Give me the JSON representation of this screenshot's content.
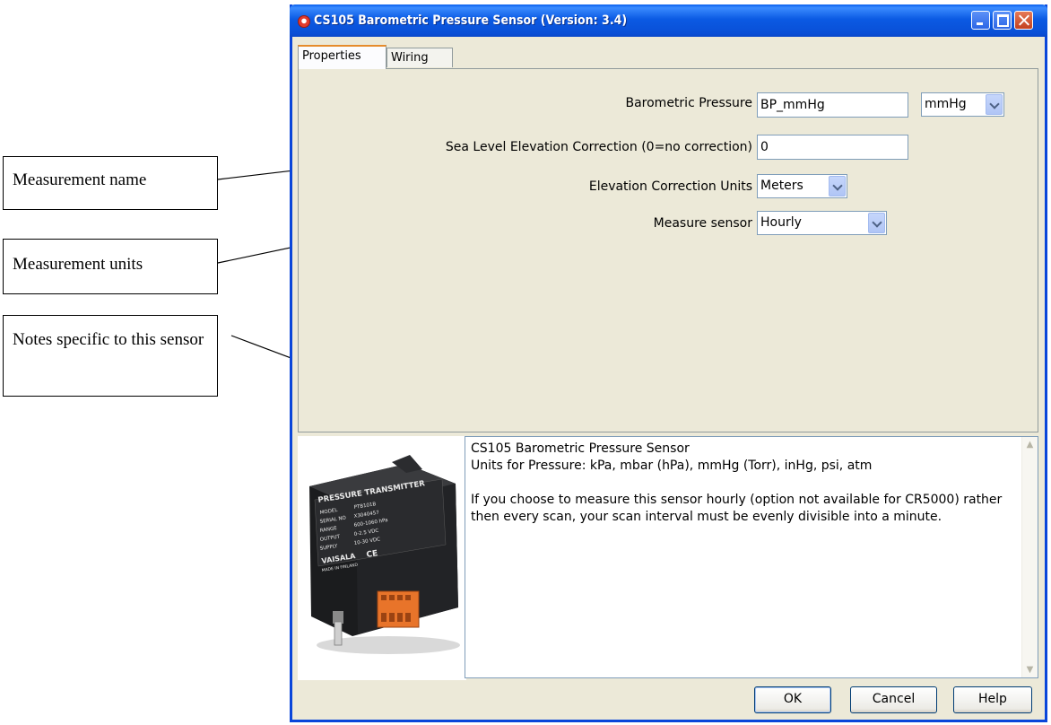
{
  "callouts": {
    "name": "Measurement name",
    "units": "Measurement units",
    "notes": "Notes specific to this sensor"
  },
  "window": {
    "title": "CS105 Barometric Pressure Sensor (Version: 3.4)"
  },
  "tabs": [
    {
      "label": "Properties",
      "active": true
    },
    {
      "label": "Wiring",
      "active": false
    }
  ],
  "form": {
    "pressure_label": "Barometric Pressure",
    "pressure_value": "BP_mmHg",
    "pressure_units": "mmHg",
    "elevation_label": "Sea Level Elevation Correction (0=no correction)",
    "elevation_value": "0",
    "elevation_units_label": "Elevation Correction Units",
    "elevation_units_value": "Meters",
    "measure_label": "Measure sensor",
    "measure_value": "Hourly"
  },
  "notes": {
    "line1": "CS105 Barometric Pressure Sensor",
    "line2": "Units for Pressure: kPa, mbar (hPa), mmHg (Torr), inHg, psi, atm",
    "line3": "If you choose to measure this sensor hourly (option not available for CR5000) rather then every scan, your scan interval must be evenly divisible into a minute."
  },
  "photo": {
    "heading": "PRESSURE TRANSMITTER",
    "rows": [
      {
        "k": "MODEL",
        "v": "PTB101B"
      },
      {
        "k": "SERIAL NO",
        "v": "X3040457"
      },
      {
        "k": "RANGE",
        "v": "600-1060 hPa"
      },
      {
        "k": "OUTPUT",
        "v": "0-2.5 VDC"
      },
      {
        "k": "SUPPLY",
        "v": "10-30 VDC"
      }
    ],
    "brand": "VAISALA",
    "ce": "CE",
    "origin": "MADE IN FINLAND"
  },
  "buttons": {
    "ok": "OK",
    "cancel": "Cancel",
    "help": "Help"
  },
  "colors": {
    "titlebar": "#0a5fee",
    "dialog_bg": "#ece9d8",
    "field_border": "#7f9db9"
  }
}
